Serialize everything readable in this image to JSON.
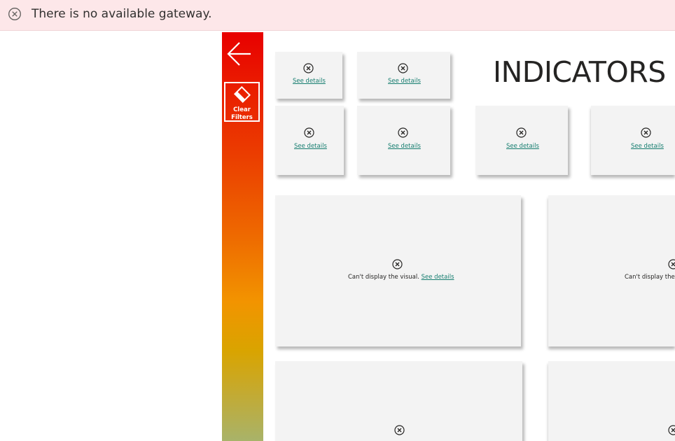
{
  "banner": {
    "message": "There is no available gateway.",
    "icon": "error-circle-icon"
  },
  "report": {
    "title": "INDICATORS",
    "back_icon": "arrow-left-icon",
    "clear_filters": {
      "label": "Clear\nFilters",
      "icon": "eraser-icon"
    },
    "tile_link_label": "See details",
    "visual_error_message": "Can't display the visual.",
    "visual_error_message_partial": "Can't display the "
  },
  "colors": {
    "banner_bg": "#fde7e9",
    "sidebar_top": "#e80000",
    "sidebar_mid": "#f29400",
    "sidebar_bottom": "#a8b36a",
    "link": "#157d6f",
    "tile_bg": "#f3f3f3"
  }
}
